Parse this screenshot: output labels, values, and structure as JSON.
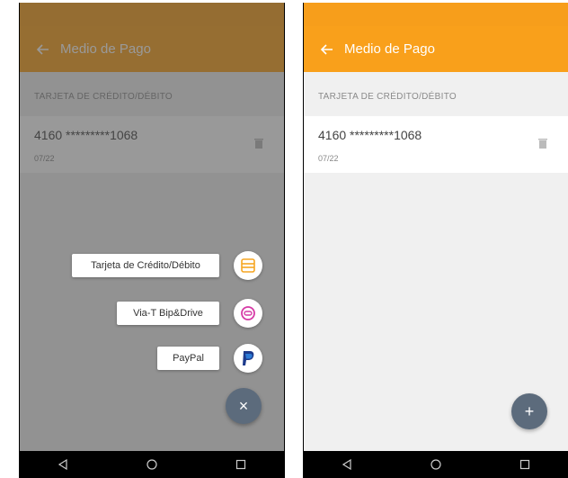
{
  "app": {
    "title": "Medio de Pago",
    "accent_color": "#f9a01b",
    "fab_color": "#5c6b7c"
  },
  "section": {
    "header": "TARJETA DE CRÉDITO/DÉBITO"
  },
  "card": {
    "number": "4160 *********1068",
    "expiry": "07/22",
    "delete_icon": "trash-icon"
  },
  "fab_menu": {
    "options": [
      {
        "label": "Tarjeta de Crédito/Débito",
        "icon": "credit-card-icon"
      },
      {
        "label": "Via-T Bip&Drive",
        "icon": "bipdrive-icon"
      },
      {
        "label": "PayPal",
        "icon": "paypal-icon"
      }
    ],
    "close_symbol": "×"
  },
  "fab": {
    "add_symbol": "+"
  },
  "navbar": {
    "icons": [
      "back-triangle-icon",
      "home-circle-icon",
      "recents-square-icon"
    ]
  }
}
